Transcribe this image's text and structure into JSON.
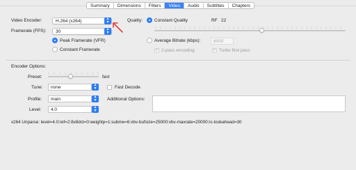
{
  "tabs": [
    {
      "label": "Summary",
      "active": false
    },
    {
      "label": "Dimensions",
      "active": false
    },
    {
      "label": "Filters",
      "active": false
    },
    {
      "label": "Video",
      "active": true
    },
    {
      "label": "Audio",
      "active": false
    },
    {
      "label": "Subtitles",
      "active": false
    },
    {
      "label": "Chapters",
      "active": false
    }
  ],
  "video": {
    "encoder_label": "Video Encoder:",
    "encoder_value": "H.264 (x264)",
    "framerate_label": "Framerate (FPS):",
    "framerate_value": "30",
    "peak_label": "Peak Framerate (VFR)",
    "constant_label": "Constant Framerate"
  },
  "quality": {
    "label": "Quality:",
    "constant_quality_label": "Constant Quality",
    "rf_label": "RF",
    "rf_value": "22",
    "avg_bitrate_label": "Average Bitrate (kbps):",
    "avg_bitrate_value": "6000",
    "two_pass_label": "2-pass encoding",
    "turbo_label": "Turbo first pass"
  },
  "encoder_options": {
    "section_label": "Encoder Options:",
    "preset_label": "Preset:",
    "preset_value_label": "fast",
    "tune_label": "Tune:",
    "tune_value": "none",
    "fast_decode_label": "Fast Decode",
    "profile_label": "Profile:",
    "profile_value": "main",
    "additional_label": "Additional Options:",
    "additional_value": "",
    "level_label": "Level:",
    "level_value": "4.0"
  },
  "unparse": "x264 Unparse: level=4.0:ref=2:8x8dct=0:weightp=1:subme=6:vbv-bufsize=25000:vbv-maxrate=20000:rc-lookahead=30",
  "colors": {
    "accent": "#2d7df6",
    "annotation_arrow": "#e03b3b"
  },
  "icons": {
    "popup_arrows": "up-down-chevron-icon",
    "annotation": "red-arrow-icon",
    "check": "checkmark-icon"
  }
}
